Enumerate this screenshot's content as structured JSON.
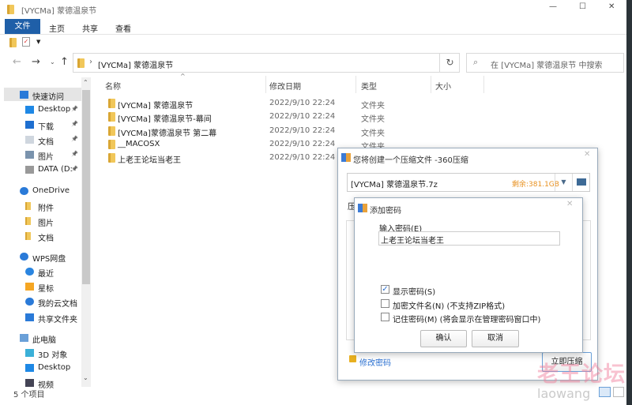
{
  "window": {
    "title": "[VYCMa] 蒙德温泉节",
    "controls": [
      "—",
      "☐",
      "✕"
    ]
  },
  "ribbon": {
    "tabs": [
      "文件",
      "主页",
      "共享",
      "查看"
    ]
  },
  "address": {
    "path": "[VYCMa] 蒙德温泉节",
    "search_placeholder": "在 [VYCMa] 蒙德温泉节 中搜索"
  },
  "columns": [
    "名称",
    "修改日期",
    "类型",
    "大小"
  ],
  "files": [
    {
      "name": "[VYCMa] 蒙德温泉节",
      "date": "2022/9/10 22:24",
      "type": "文件夹"
    },
    {
      "name": "[VYCMa] 蒙德温泉节-幕间",
      "date": "2022/9/10 22:24",
      "type": "文件夹"
    },
    {
      "name": "[VYCMa]蒙德温泉节 第二幕",
      "date": "2022/9/10 22:24",
      "type": "文件夹"
    },
    {
      "name": "__MACOSX",
      "date": "2022/9/10 22:24",
      "type": "文件夹"
    },
    {
      "name": "上老王论坛当老王",
      "date": "2022/9/10 22:24",
      "type": "文件夹"
    }
  ],
  "sidebar": {
    "items": [
      {
        "label": "快速访问",
        "icon": "star-icon",
        "level": 0
      },
      {
        "label": "Desktop",
        "icon": "desktop-icon",
        "level": 1,
        "pinned": true
      },
      {
        "label": "下载",
        "icon": "download-icon",
        "level": 1,
        "pinned": true
      },
      {
        "label": "文档",
        "icon": "document-icon",
        "level": 1,
        "pinned": true
      },
      {
        "label": "图片",
        "icon": "picture-icon",
        "level": 1,
        "pinned": true
      },
      {
        "label": "DATA (D:",
        "icon": "drive-icon",
        "level": 1,
        "pinned": true
      },
      {
        "label": "OneDrive",
        "icon": "cloud-icon",
        "level": 0
      },
      {
        "label": "附件",
        "icon": "folder-icon",
        "level": 1
      },
      {
        "label": "图片",
        "icon": "folder-icon",
        "level": 1
      },
      {
        "label": "文档",
        "icon": "folder-icon",
        "level": 1
      },
      {
        "label": "WPS网盘",
        "icon": "cloud-icon",
        "level": 0
      },
      {
        "label": "最近",
        "icon": "clock-icon",
        "level": 1
      },
      {
        "label": "星标",
        "icon": "star-icon",
        "level": 1
      },
      {
        "label": "我的云文档",
        "icon": "cloud-icon",
        "level": 1
      },
      {
        "label": "共享文件夹",
        "icon": "share-icon",
        "level": 1
      },
      {
        "label": "此电脑",
        "icon": "computer-icon",
        "level": 0
      },
      {
        "label": "3D 对象",
        "icon": "cube-icon",
        "level": 1
      },
      {
        "label": "Desktop",
        "icon": "desktop-icon",
        "level": 1
      },
      {
        "label": "视频",
        "icon": "video-icon",
        "level": 1
      }
    ]
  },
  "status": {
    "count": "5 个项目"
  },
  "compress": {
    "title": "您将创建一个压缩文件 -360压缩",
    "filename": "[VYCMa] 蒙德温泉节.7z",
    "free": "剩余:381.1GB",
    "label_cut": "压",
    "change_password": "修改密码",
    "compress_now": "立即压缩",
    "free_color": "#e8901e"
  },
  "password": {
    "title": "添加密码",
    "label": "输入密码(E)",
    "value": "上老王论坛当老王",
    "options": [
      {
        "label": "显示密码(S)",
        "checked": true
      },
      {
        "label": "加密文件名(N) (不支持ZIP格式)",
        "checked": false
      },
      {
        "label": "记住密码(M) (将会显示在管理密码窗口中)",
        "checked": false
      }
    ],
    "ok": "确认",
    "cancel": "取消"
  },
  "watermark": {
    "cn": "老王论坛",
    "en": "laowang"
  }
}
